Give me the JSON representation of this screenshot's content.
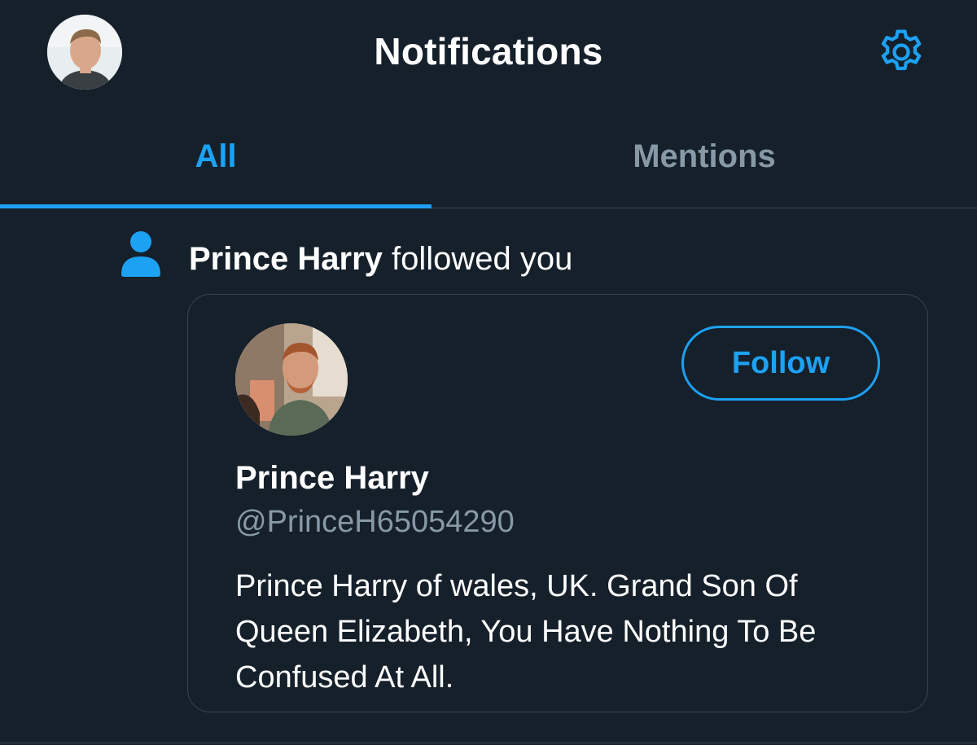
{
  "header": {
    "title": "Notifications",
    "avatar_icon": "user-avatar-photo",
    "settings_icon": "gear-icon"
  },
  "tabs": [
    {
      "label": "All",
      "active": true
    },
    {
      "label": "Mentions",
      "active": false
    }
  ],
  "notification": {
    "icon": "person-icon",
    "actor_name": "Prince Harry",
    "action_text": " followed you",
    "card": {
      "display_name": "Prince Harry",
      "handle": "@PrinceH65054290",
      "bio": "Prince Harry of wales, UK. Grand Son Of Queen Elizabeth, You Have Nothing To Be Confused At All.",
      "follow_label": "Follow"
    }
  },
  "colors": {
    "background": "#15202b",
    "accent": "#1da1f2",
    "secondary_text": "#8899a6",
    "border": "#38444d"
  }
}
